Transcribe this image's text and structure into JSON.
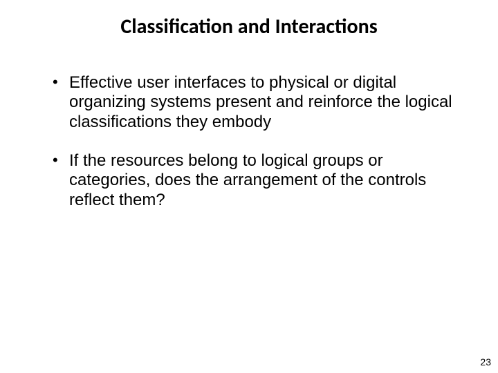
{
  "slide": {
    "title": "Classification and Interactions",
    "bullets": [
      "Effective user interfaces to physical or digital organizing systems present and reinforce the logical classifications they embody",
      "If the resources belong to logical groups or categories, does the arrangement of the controls reflect them?"
    ],
    "page_number": "23"
  }
}
